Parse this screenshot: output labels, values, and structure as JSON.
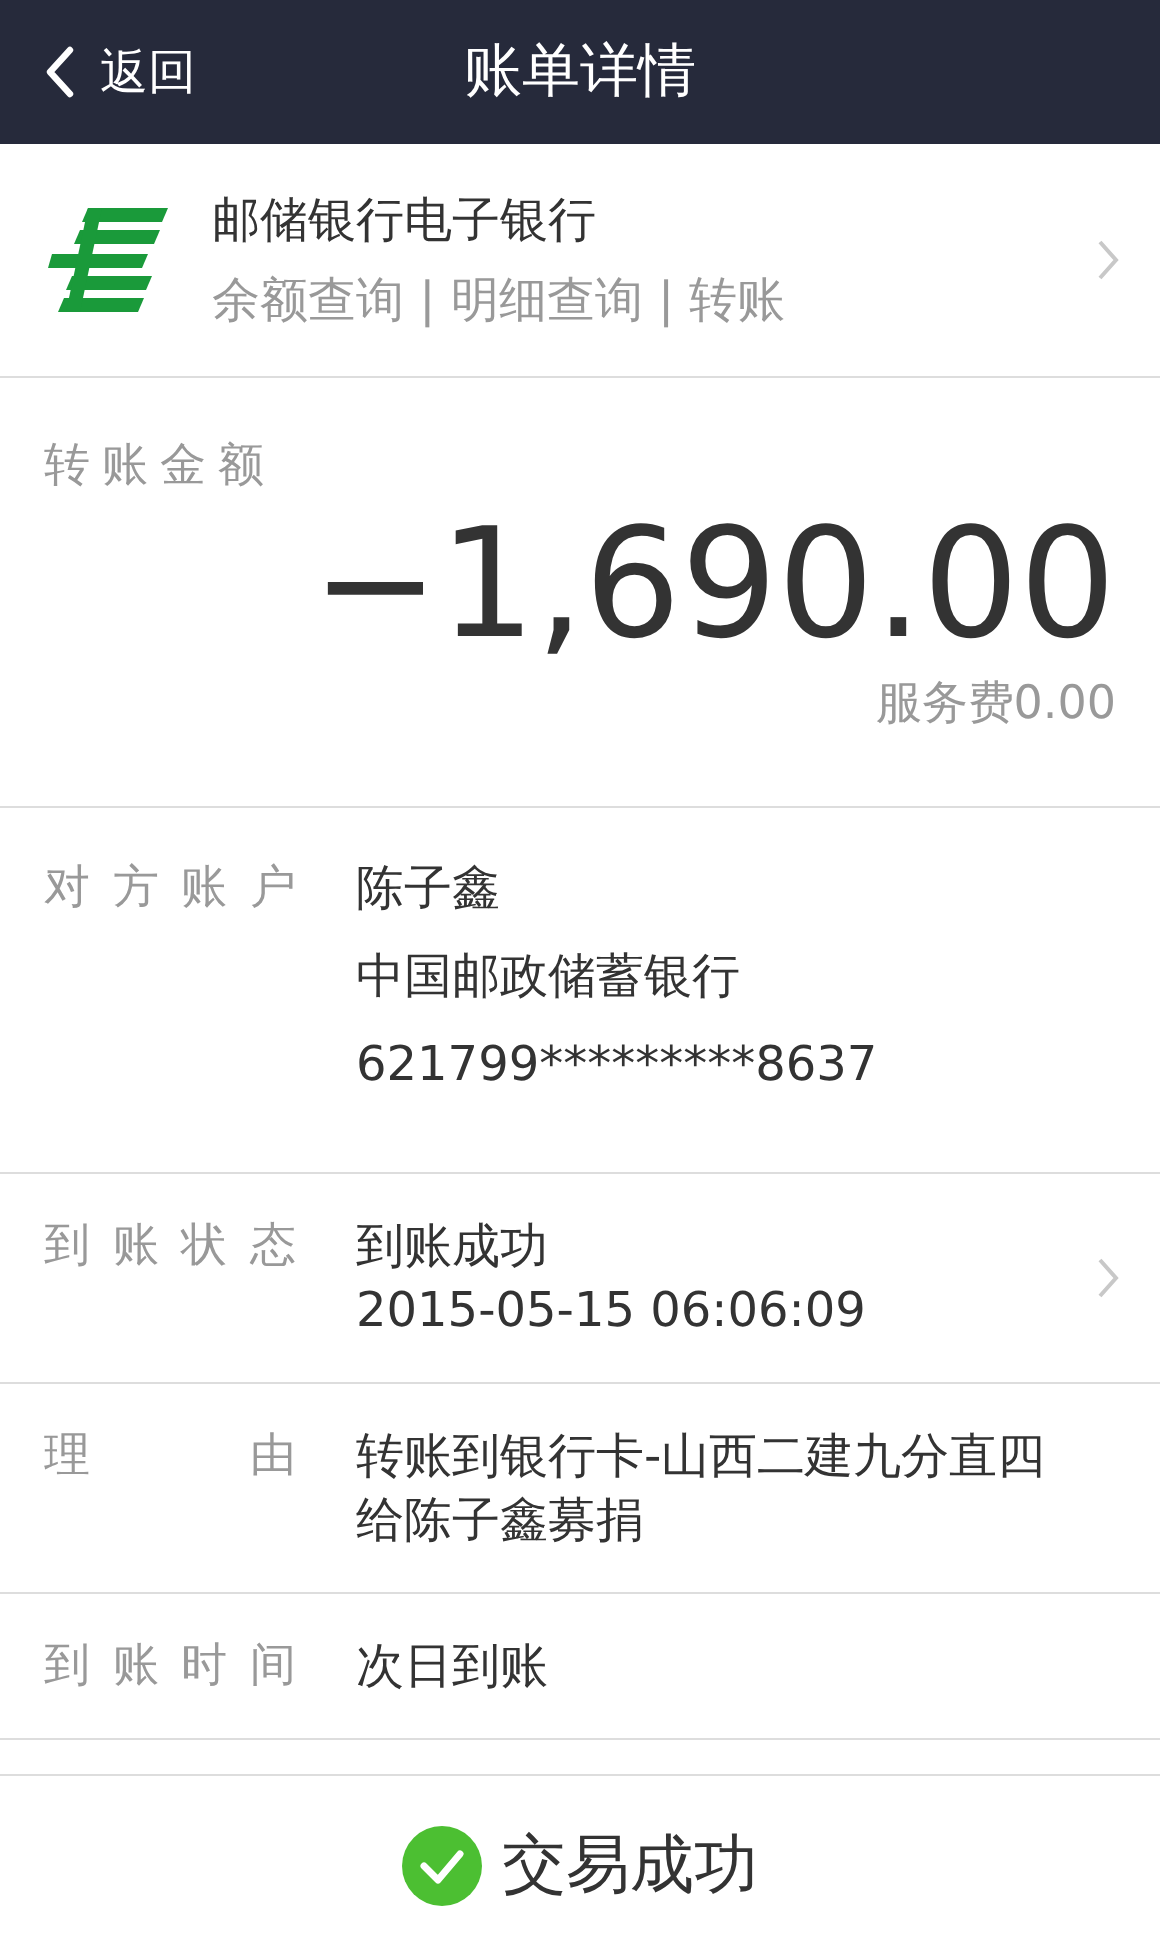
{
  "header": {
    "back": "返回",
    "title": "账单详情"
  },
  "bank": {
    "name": "邮储银行电子银行",
    "links": "余额查询 | 明细查询 | 转账",
    "chevron": true
  },
  "amount": {
    "label": "转账金额",
    "value": "−1,690.00",
    "fee": "服务费0.00"
  },
  "details": [
    {
      "label": "对方账户",
      "lines": [
        "陈子鑫",
        "中国邮政储蓄银行",
        "621799*********8637"
      ],
      "chevron": false
    },
    {
      "label": "到账状态",
      "lines": [
        "到账成功",
        "2015-05-15 06:06:09"
      ],
      "chevron": true
    },
    {
      "label": "理由",
      "lines": [
        "转账到银行卡-山西二建九分直四给陈子鑫募捐"
      ],
      "chevron": false
    },
    {
      "label": "到账时间",
      "lines": [
        "次日到账"
      ],
      "chevron": false
    }
  ],
  "result": {
    "text": "交易成功",
    "success": true
  }
}
